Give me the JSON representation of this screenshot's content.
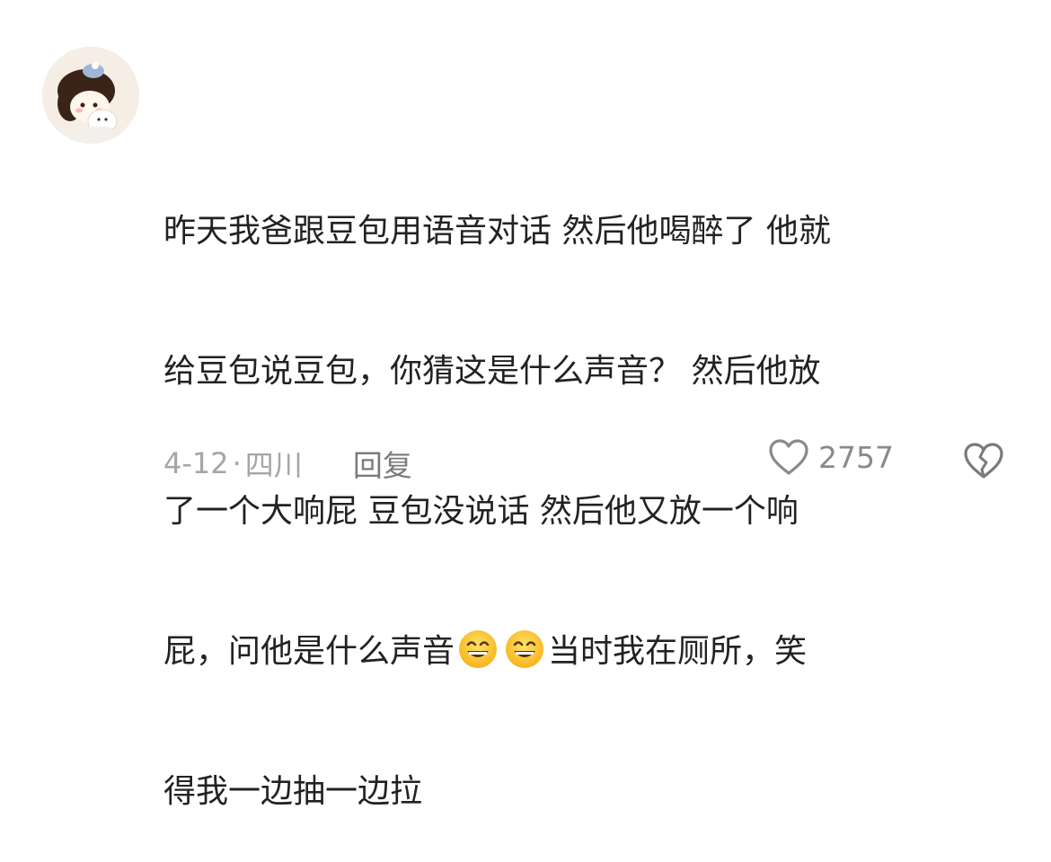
{
  "comment": {
    "lines": [
      "昨天我爸跟豆包用语音对话 然后他喝醉了 他就",
      "给豆包说豆包，你猜这是什么声音？ 然后他放",
      "了一个大响屁 豆包没说话 然后他又放一个响",
      "屁，问他是什么声音",
      "当时我在厕所，笑",
      "得我一边抽一边拉"
    ],
    "emoji_icon": "grinning-squint-face-icon"
  },
  "meta": {
    "date": "4-12",
    "separator": "·",
    "location": "四川",
    "reply_label": "回复"
  },
  "actions": {
    "like_count": "2757",
    "like_icon": "heart-outline-icon",
    "dislike_icon": "broken-heart-icon"
  }
}
